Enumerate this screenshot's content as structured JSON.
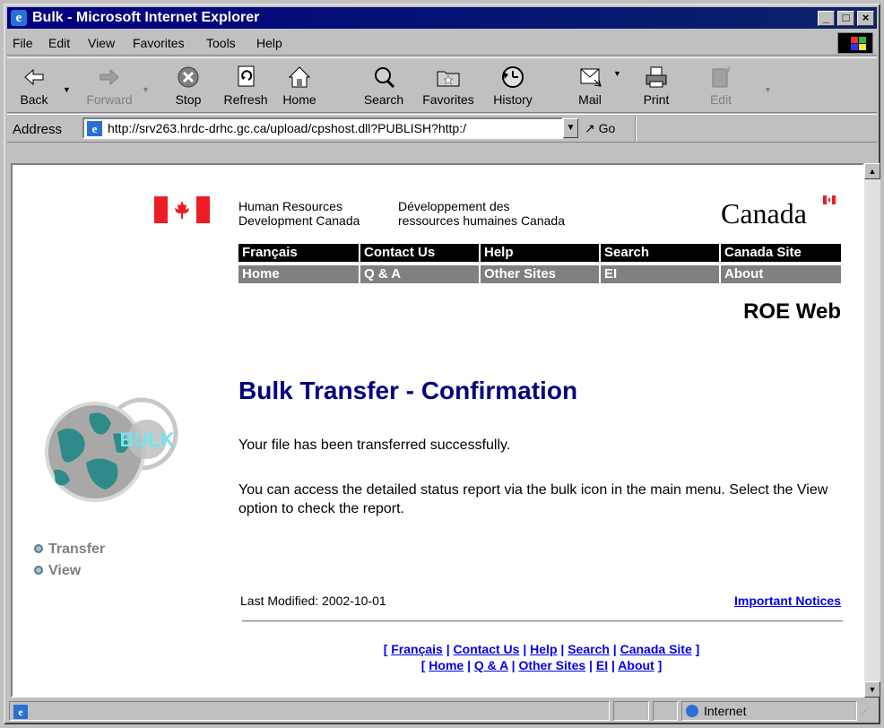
{
  "window": {
    "title": "Bulk - Microsoft Internet Explorer"
  },
  "menu": [
    "File",
    "Edit",
    "View",
    "Favorites",
    "Tools",
    "Help"
  ],
  "toolbar": {
    "back": "Back",
    "forward": "Forward",
    "stop": "Stop",
    "refresh": "Refresh",
    "home": "Home",
    "search": "Search",
    "favorites": "Favorites",
    "history": "History",
    "mail": "Mail",
    "print": "Print",
    "edit": "Edit"
  },
  "address": {
    "label": "Address",
    "url": "http://srv263.hrdc-drhc.gc.ca/upload/cpshost.dll?PUBLISH?http:/",
    "go": "Go"
  },
  "header": {
    "dept_en_line1": "Human Resources",
    "dept_en_line2": "Development Canada",
    "dept_fr_line1": "Développement des",
    "dept_fr_line2": "ressources humaines Canada",
    "wordmark": "Canada"
  },
  "nav_top": [
    "Français",
    "Contact Us",
    "Help",
    "Search",
    "Canada Site"
  ],
  "nav_bottom": [
    "Home",
    "Q & A",
    "Other Sites",
    "EI",
    "About"
  ],
  "app_name": "ROE Web",
  "bulk_logo_text": "BULK",
  "side_menu": [
    "Transfer",
    "View"
  ],
  "page": {
    "heading": "Bulk Transfer - Confirmation",
    "message1": "Your file has been transferred successfully.",
    "message2": "You can access the detailed status report via the bulk icon in the main menu. Select the View option to check the report."
  },
  "footer": {
    "last_modified": "Last Modified: 2002-10-01",
    "notices": "Important Notices",
    "links_row1": [
      "Français",
      "Contact Us",
      "Help",
      "Search",
      "Canada Site"
    ],
    "links_row2": [
      "Home",
      "Q & A",
      "Other Sites",
      "EI",
      "About"
    ]
  },
  "status": {
    "zone": "Internet"
  },
  "colors": {
    "title_bar": "#000080",
    "heading": "#000080",
    "link": "#0000ee",
    "nav_top": "#000000",
    "nav_bottom": "#808080",
    "flag_red": "#ee1c25"
  }
}
